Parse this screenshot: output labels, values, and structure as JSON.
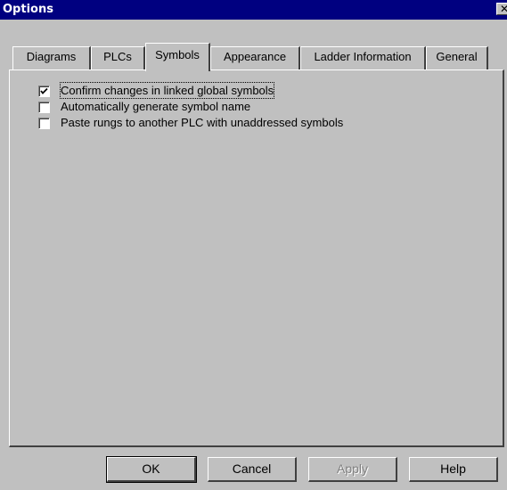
{
  "window": {
    "title": "Options",
    "close_label": "✕"
  },
  "tabs": [
    {
      "label": "Diagrams",
      "active": false
    },
    {
      "label": "PLCs",
      "active": false
    },
    {
      "label": "Symbols",
      "active": true
    },
    {
      "label": "Appearance",
      "active": false
    },
    {
      "label": "Ladder Information",
      "active": false
    },
    {
      "label": "General",
      "active": false
    }
  ],
  "options": [
    {
      "label": "Confirm changes in linked global symbols",
      "checked": true
    },
    {
      "label": "Automatically generate symbol name",
      "checked": false
    },
    {
      "label": "Paste rungs to another PLC with unaddressed symbols",
      "checked": false
    }
  ],
  "buttons": {
    "ok": "OK",
    "cancel": "Cancel",
    "apply": "Apply",
    "help": "Help"
  }
}
